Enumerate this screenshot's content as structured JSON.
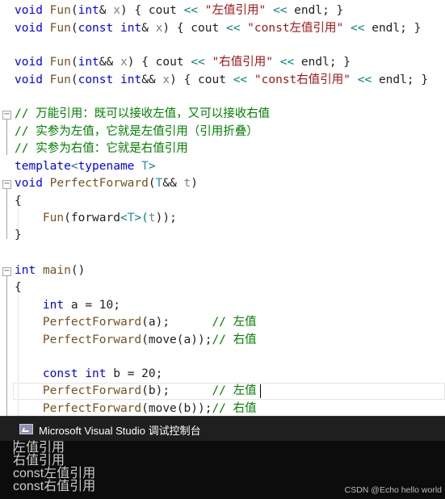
{
  "editor": {
    "lines": [
      [
        "void",
        " ",
        "Fun",
        "(",
        "int",
        "& ",
        "x",
        ") { cout ",
        "<<",
        " ",
        "\"左值引用\"",
        " ",
        "<<",
        " endl; }"
      ],
      [
        "void",
        " ",
        "Fun",
        "(",
        "const",
        " ",
        "int",
        "& ",
        "x",
        ") { cout ",
        "<<",
        " ",
        "\"const左值引用\"",
        " ",
        "<<",
        " endl; }"
      ],
      [
        "void",
        " ",
        "Fun",
        "(",
        "int",
        "&& ",
        "x",
        ") { cout ",
        "<<",
        " ",
        "\"右值引用\"",
        " ",
        "<<",
        " endl; }"
      ],
      [
        "void",
        " ",
        "Fun",
        "(",
        "const",
        " ",
        "int",
        "&& ",
        "x",
        ") { cout ",
        "<<",
        " ",
        "\"const右值引用\"",
        " ",
        "<<",
        " endl; }"
      ],
      [
        "// 万能引用：既可以接收左值，又可以接收右值"
      ],
      [
        "// 实参为左值，它就是左值引用（引用折叠）"
      ],
      [
        "// 实参为右值：它就是右值引用"
      ],
      [
        "template",
        "<",
        "typename",
        " ",
        "T",
        ">"
      ],
      [
        "void",
        " ",
        "PerfectForward",
        "(",
        "T",
        "&& ",
        "t",
        ")"
      ],
      [
        "{"
      ],
      [
        "    ",
        "Fun",
        "(forward",
        "<",
        "T",
        ">(",
        "t",
        "));"
      ],
      [
        "}"
      ],
      [
        "int",
        " ",
        "main",
        "()"
      ],
      [
        "{"
      ],
      [
        "    ",
        "int",
        " a = 10;"
      ],
      [
        "    ",
        "PerfectForward",
        "(a);      ",
        "// 左值"
      ],
      [
        "    ",
        "PerfectForward",
        "(move(a));",
        "// 右值"
      ],
      [
        "    ",
        "const",
        " ",
        "int",
        " b = 20;"
      ],
      [
        "    ",
        "PerfectForward",
        "(b);      ",
        "// 左值"
      ],
      [
        "    ",
        "PerfectForward",
        "(move(b));",
        "// 右值"
      ]
    ]
  },
  "console": {
    "title": "Microsoft Visual Studio 调试控制台",
    "output": [
      "左值引用",
      "右值引用",
      "const左值引用",
      "const右值引用"
    ]
  },
  "watermark": "CSDN @Echo hello world",
  "colors": {
    "keyword": "#0000ff",
    "function": "#74531f",
    "string": "#a31515",
    "comment": "#008000",
    "type_param": "#2b91af",
    "parameter": "#808080",
    "operator": "#008080",
    "console_bg": "#0c0c0c"
  }
}
